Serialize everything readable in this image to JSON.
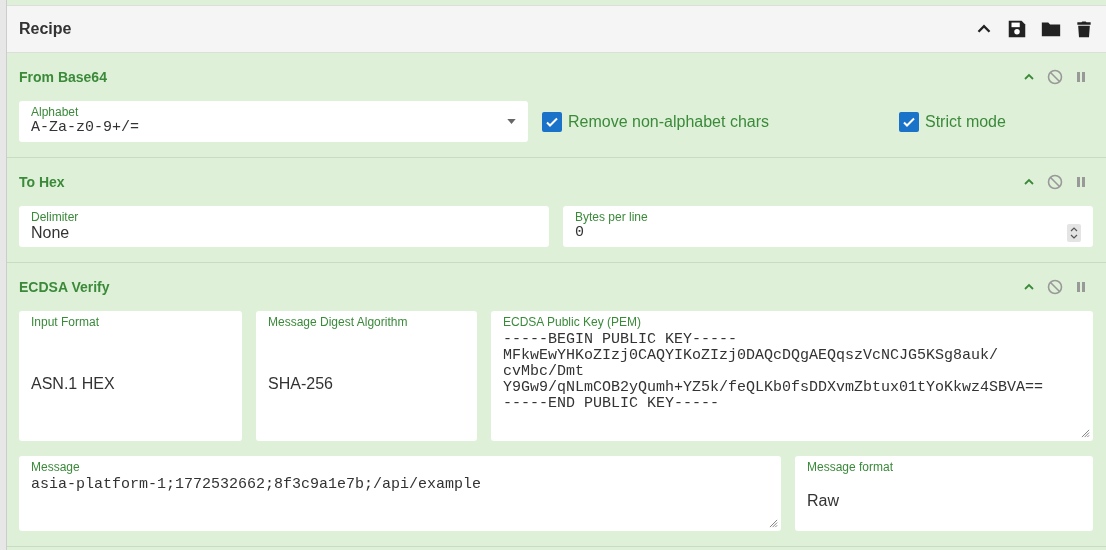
{
  "recipe": {
    "title": "Recipe"
  },
  "operations": [
    {
      "title": "From Base64",
      "fields": [
        {
          "kind": "dropdown",
          "label": "Alphabet",
          "value": "A-Za-z0-9+/="
        },
        {
          "kind": "checkbox",
          "label": "Remove non-alphabet chars",
          "checked": true
        },
        {
          "kind": "checkbox",
          "label": "Strict mode",
          "checked": true
        }
      ]
    },
    {
      "title": "To Hex",
      "fields": [
        {
          "kind": "text",
          "label": "Delimiter",
          "value": "None"
        },
        {
          "kind": "number",
          "label": "Bytes per line",
          "value": "0"
        }
      ]
    },
    {
      "title": "ECDSA Verify",
      "fields": [
        {
          "kind": "choice",
          "label": "Input Format",
          "value": "ASN.1 HEX"
        },
        {
          "kind": "choice",
          "label": "Message Digest Algorithm",
          "value": "SHA-256"
        },
        {
          "kind": "textarea",
          "label": "ECDSA Public Key (PEM)",
          "value": "-----BEGIN PUBLIC KEY-----\nMFkwEwYHKoZIzj0CAQYIKoZIzj0DAQcDQgAEQqszVcNCJG5KSg8auk/\ncvMbc/Dmt\nY9Gw9/qNLmCOB2yQumh+YZ5k/feQLKb0fsDDXvmZbtux01tYoKkwz4SBVA==\n-----END PUBLIC KEY-----"
        },
        {
          "kind": "textarea",
          "label": "Message",
          "value": "asia-platform-1;1772532662;8f3c9a1e7b;/api/example"
        },
        {
          "kind": "choice",
          "label": "Message format",
          "value": "Raw"
        }
      ]
    }
  ]
}
